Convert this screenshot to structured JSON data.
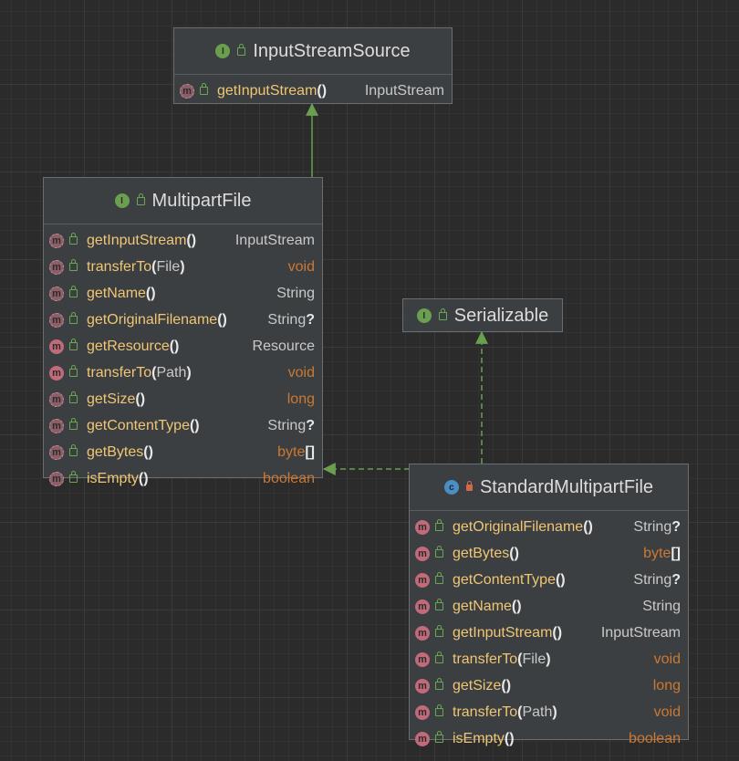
{
  "nodes": {
    "input_stream_source": {
      "name": "InputStreamSource",
      "kind": "interface",
      "members": [
        {
          "name": "getInputStream",
          "params": "",
          "returns": "InputStream",
          "primitive": false,
          "suffix": ""
        }
      ]
    },
    "multipart_file": {
      "name": "MultipartFile",
      "kind": "interface",
      "members": [
        {
          "name": "getInputStream",
          "params": "",
          "returns": "InputStream",
          "primitive": false,
          "suffix": ""
        },
        {
          "name": "transferTo",
          "params": "File",
          "returns": "void",
          "primitive": true,
          "suffix": ""
        },
        {
          "name": "getName",
          "params": "",
          "returns": "String",
          "primitive": false,
          "suffix": ""
        },
        {
          "name": "getOriginalFilename",
          "params": "",
          "returns": "String",
          "primitive": false,
          "suffix": "?"
        },
        {
          "name": "getResource",
          "params": "",
          "returns": "Resource",
          "primitive": false,
          "suffix": ""
        },
        {
          "name": "transferTo",
          "params": "Path",
          "returns": "void",
          "primitive": true,
          "suffix": ""
        },
        {
          "name": "getSize",
          "params": "",
          "returns": "long",
          "primitive": true,
          "suffix": ""
        },
        {
          "name": "getContentType",
          "params": "",
          "returns": "String",
          "primitive": false,
          "suffix": "?"
        },
        {
          "name": "getBytes",
          "params": "",
          "returns": "byte",
          "primitive": true,
          "suffix": "[]"
        },
        {
          "name": "isEmpty",
          "params": "",
          "returns": "boolean",
          "primitive": true,
          "suffix": ""
        }
      ]
    },
    "serializable": {
      "name": "Serializable",
      "kind": "interface",
      "members": []
    },
    "standard_multipart_file": {
      "name": "StandardMultipartFile",
      "kind": "class",
      "members": [
        {
          "name": "getOriginalFilename",
          "params": "",
          "returns": "String",
          "primitive": false,
          "suffix": "?"
        },
        {
          "name": "getBytes",
          "params": "",
          "returns": "byte",
          "primitive": true,
          "suffix": "[]"
        },
        {
          "name": "getContentType",
          "params": "",
          "returns": "String",
          "primitive": false,
          "suffix": "?"
        },
        {
          "name": "getName",
          "params": "",
          "returns": "String",
          "primitive": false,
          "suffix": ""
        },
        {
          "name": "getInputStream",
          "params": "",
          "returns": "InputStream",
          "primitive": false,
          "suffix": ""
        },
        {
          "name": "transferTo",
          "params": "File",
          "returns": "void",
          "primitive": true,
          "suffix": ""
        },
        {
          "name": "getSize",
          "params": "",
          "returns": "long",
          "primitive": true,
          "suffix": ""
        },
        {
          "name": "transferTo",
          "params": "Path",
          "returns": "void",
          "primitive": true,
          "suffix": ""
        },
        {
          "name": "isEmpty",
          "params": "",
          "returns": "boolean",
          "primitive": true,
          "suffix": ""
        }
      ]
    }
  },
  "edges": [
    {
      "from": "multipart_file",
      "to": "input_stream_source",
      "type": "extends"
    },
    {
      "from": "standard_multipart_file",
      "to": "serializable",
      "type": "implements"
    },
    {
      "from": "standard_multipart_file",
      "to": "multipart_file",
      "type": "implements"
    }
  ],
  "colors": {
    "edge": "#6a9f4f",
    "node_bg": "#3c3f41",
    "method_name": "#f0c674",
    "primitive_type": "#cc7832"
  }
}
